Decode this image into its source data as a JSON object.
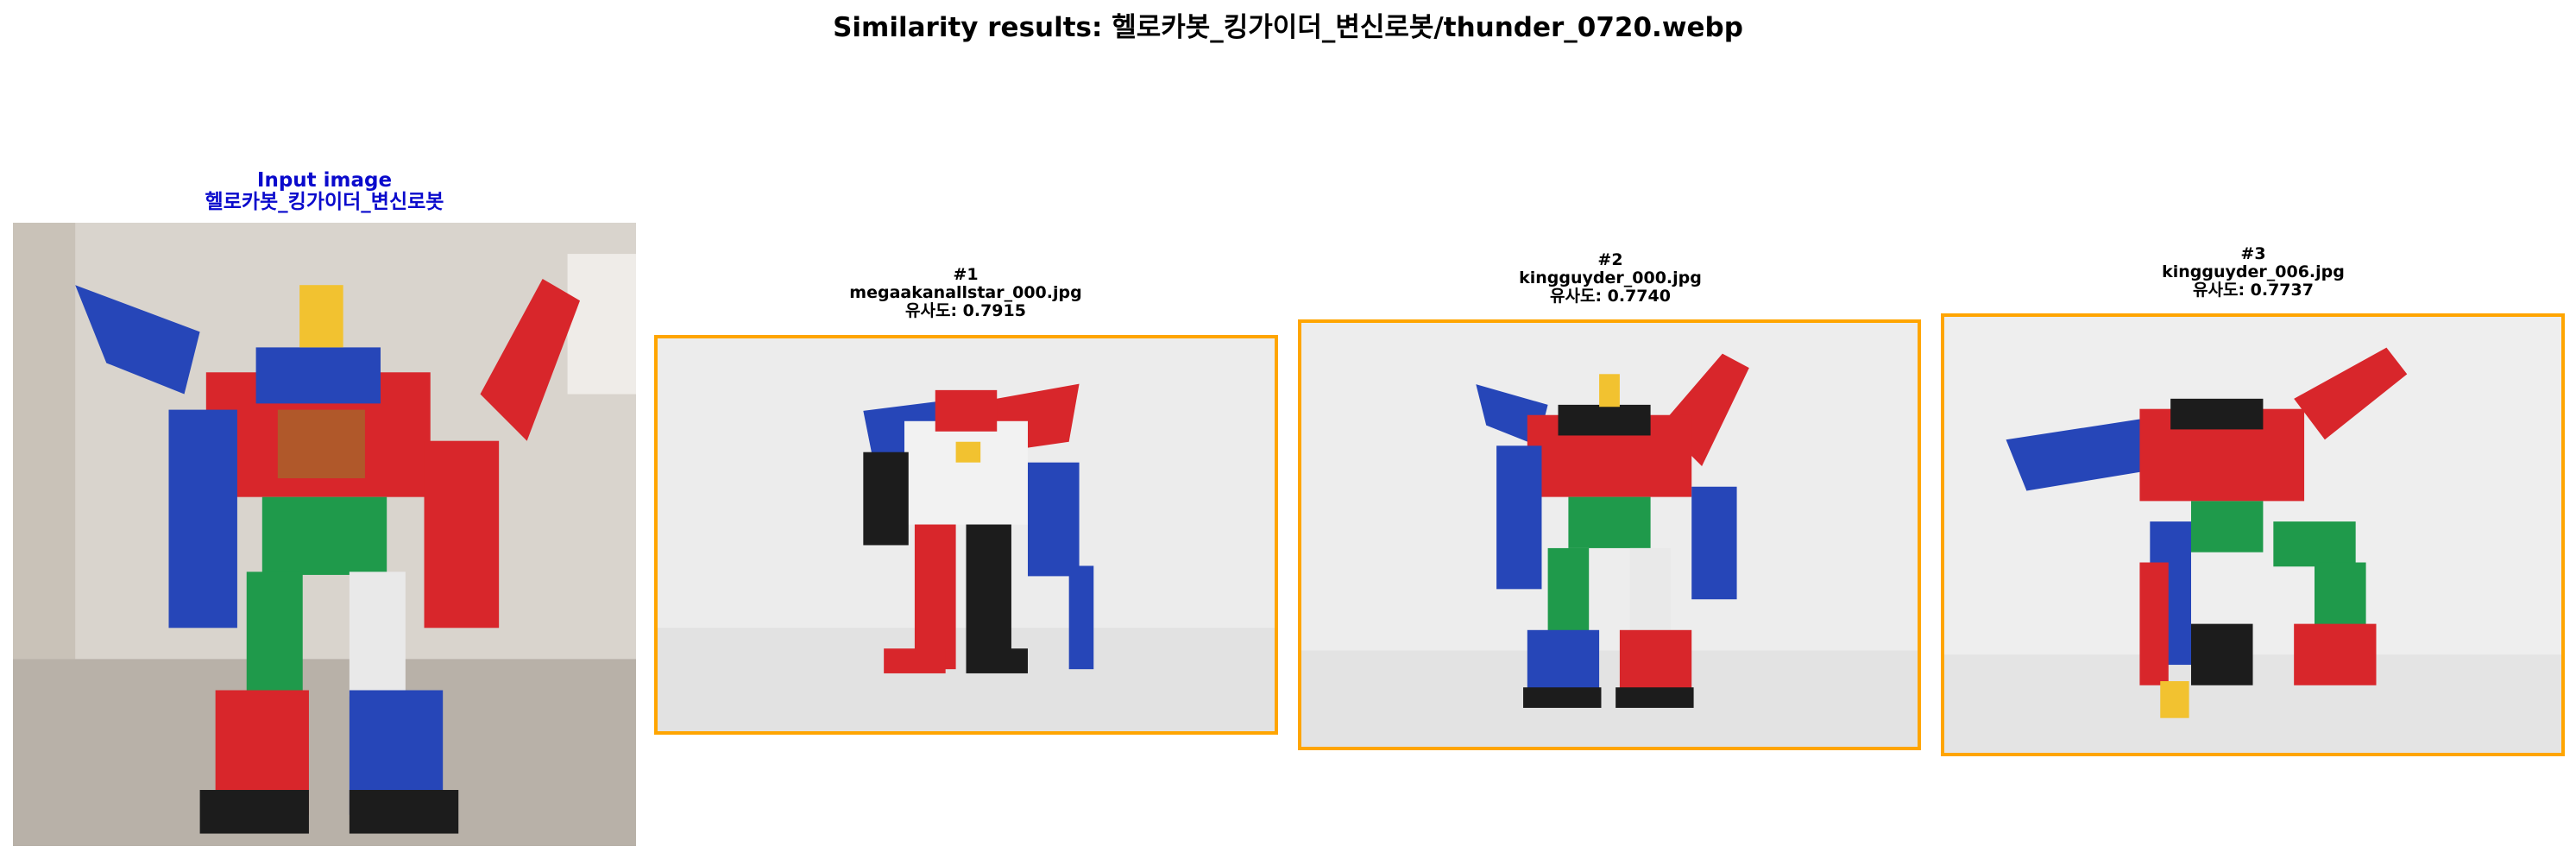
{
  "title": "Similarity results: 헬로카봇_킹가이더_변신로봇/thunder_0720.webp",
  "colors": {
    "input_caption": "#0a0acc",
    "result_border": "#ffa500",
    "robot_red": "#d8262b",
    "robot_blue": "#2646b8",
    "robot_green": "#1f9a4b",
    "robot_black": "#1c1c1c",
    "robot_white": "#f2f2f2",
    "robot_yellow": "#f2c230"
  },
  "input": {
    "heading": "Input image",
    "name": "헬로카봇_킹가이더_변신로봇"
  },
  "results": [
    {
      "rank": "#1",
      "filename": "megaakanallstar_000.jpg",
      "similarity": "유사도: 0.7915"
    },
    {
      "rank": "#2",
      "filename": "kingguyder_000.jpg",
      "similarity": "유사도: 0.7740"
    },
    {
      "rank": "#3",
      "filename": "kingguyder_006.jpg",
      "similarity": "유사도: 0.7737"
    }
  ]
}
